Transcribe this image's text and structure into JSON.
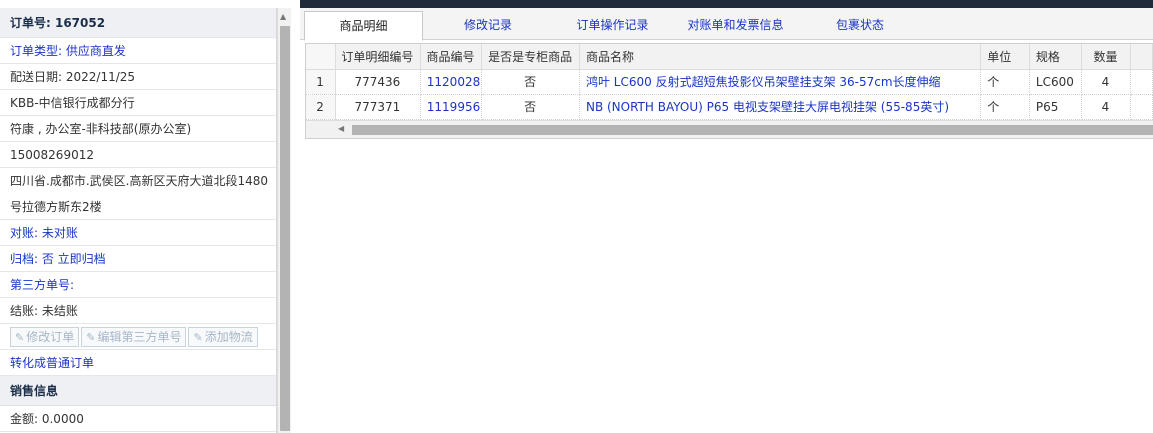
{
  "order": {
    "number_label": "订单号: 167052",
    "type": "订单类型: 供应商直发",
    "delivery_date": "配送日期: 2022/11/25",
    "branch": "KBB-中信银行成都分行",
    "contact": "符康 , 办公室-非科技部(原办公室)",
    "phone": "15008269012",
    "address_line1": "四川省.成都市.武侯区.高新区天府大道北段1480",
    "address_line2": "号拉德方斯东2楼",
    "reconcile": "对账: 未对账",
    "archive": "归档:  否 立即归档",
    "third_party": "第三方单号:",
    "settlement": "结账: 未结账",
    "actions": {
      "modify": "修改订单",
      "edit_third": "编辑第三方单号",
      "add_logistics": "添加物流"
    },
    "convert": "转化成普通订单"
  },
  "sales": {
    "title": "销售信息",
    "amount": "金额: 0.0000"
  },
  "tabs": [
    "商品明细",
    "修改记录",
    "订单操作记录",
    "对账单和发票信息",
    "包裹状态"
  ],
  "table": {
    "headers": [
      "",
      "订单明细编号",
      "商品编号",
      "是否是专柜商品",
      "商品名称",
      "单位",
      "规格",
      "数量"
    ],
    "rows": [
      {
        "index": "1",
        "detail_id": "777436",
        "product_id": "1120028",
        "counter": "否",
        "name": "鸿叶 LC600 反射式超短焦投影仪吊架壁挂支架 36-57cm长度伸缩",
        "unit": "个",
        "spec": "LC600",
        "qty": "4"
      },
      {
        "index": "2",
        "detail_id": "777371",
        "product_id": "1119956",
        "counter": "否",
        "name": "NB (NORTH BAYOU) P65 电视支架壁挂大屏电视挂架 (55-85英寸)",
        "unit": "个",
        "spec": "P65",
        "qty": "4"
      }
    ]
  },
  "icons": {
    "edit": "edit-icon",
    "scroll_up": "arrow-up-icon",
    "scroll_left": "arrow-left-icon"
  }
}
